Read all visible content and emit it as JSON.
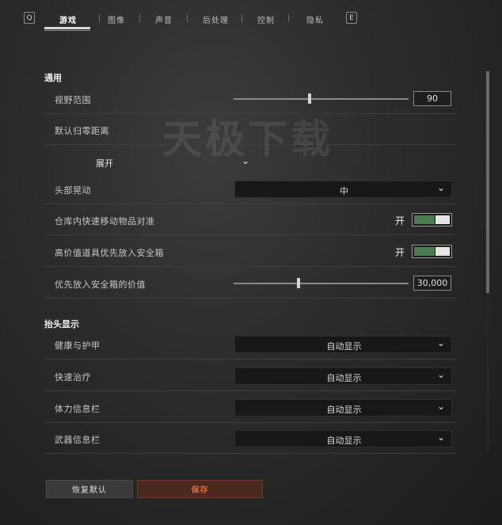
{
  "topbar": {
    "prev_key": "Q",
    "next_key": "E",
    "tabs": [
      {
        "label": "游戏",
        "active": true
      },
      {
        "label": "图像",
        "active": false
      },
      {
        "label": "声音",
        "active": false
      },
      {
        "label": "后处理",
        "active": false
      },
      {
        "label": "控制",
        "active": false
      },
      {
        "label": "隐私",
        "active": false
      }
    ]
  },
  "watermark": "天极下载",
  "general": {
    "title": "通用",
    "fov": {
      "label": "视野范围",
      "value": "90"
    },
    "zeroing": {
      "label": "默认归零距离",
      "expand_label": "展开"
    },
    "head_bob": {
      "label": "头部晃动",
      "value": "中"
    },
    "quick_move": {
      "label": "仓库内快速移动物品对准",
      "state": "开"
    },
    "high_value": {
      "label": "高价值道具优先放入安全箱",
      "state": "开"
    },
    "priority_value": {
      "label": "优先放入安全箱的价值",
      "value": "30,000"
    }
  },
  "hud": {
    "title": "抬头显示",
    "items": [
      {
        "label": "健康与护甲",
        "value": "自动显示"
      },
      {
        "label": "快速治疗",
        "value": "自动显示"
      },
      {
        "label": "体力信息栏",
        "value": "自动显示"
      },
      {
        "label": "武器信息栏",
        "value": "自动显示"
      }
    ]
  },
  "footer": {
    "reset_label": "恢复默认",
    "save_label": "保存"
  },
  "colors": {
    "toggle_on": "#4d7a52",
    "save_text": "#e26a3a",
    "save_bg": "#4a2a1f"
  }
}
